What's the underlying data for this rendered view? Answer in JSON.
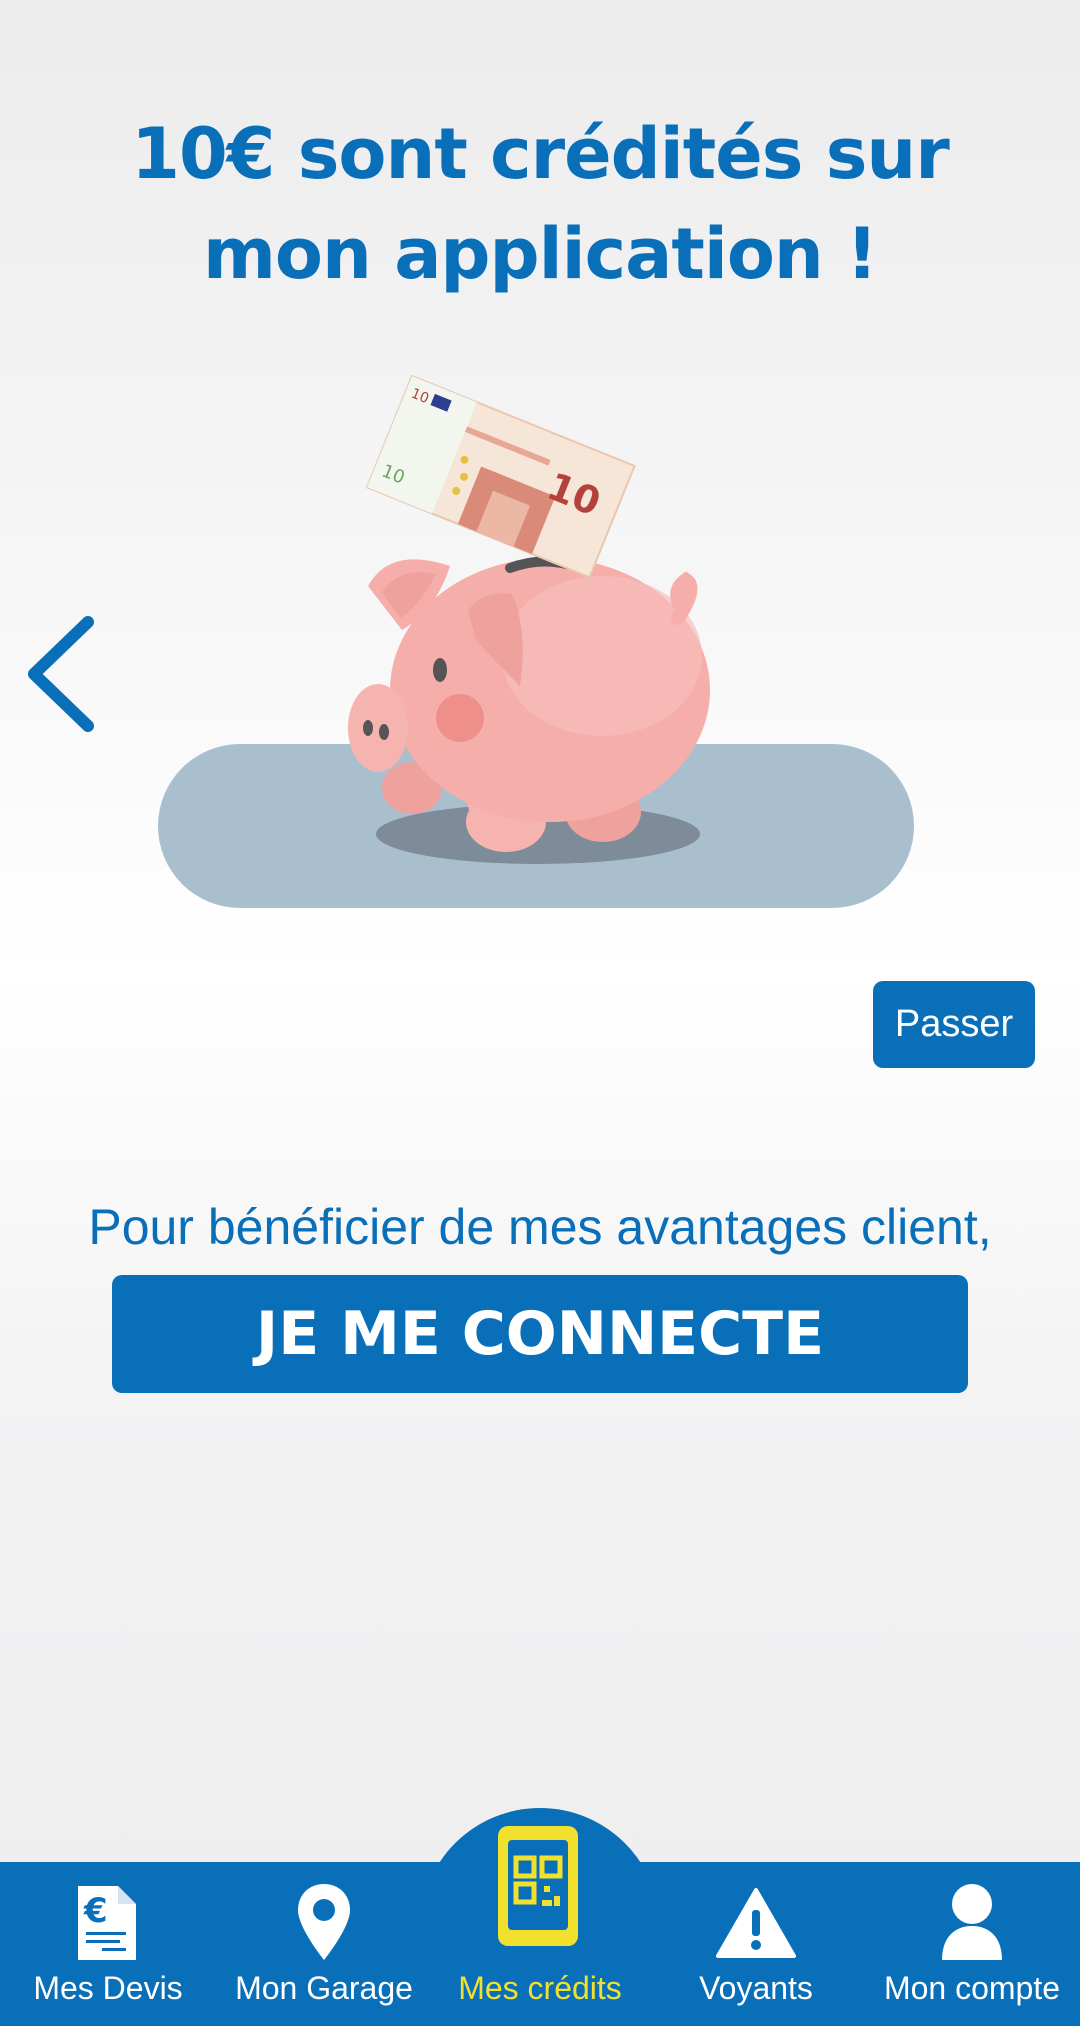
{
  "onboarding": {
    "title": "10€ sont crédités sur mon application !",
    "skip_label": "Passer",
    "benefit_text": "Pour bénéficier de mes avantages client,",
    "connect_label": "JE ME CONNECTE",
    "banknote_value": "10"
  },
  "nav": {
    "items": [
      {
        "label": "Mes Devis",
        "icon": "quote-document-icon"
      },
      {
        "label": "Mon Garage",
        "icon": "location-pin-icon"
      },
      {
        "label": "Mes crédits",
        "icon": "qr-phone-icon",
        "active": true
      },
      {
        "label": "Voyants",
        "icon": "warning-icon"
      },
      {
        "label": "Mon compte",
        "icon": "user-icon"
      }
    ]
  },
  "colors": {
    "primary": "#0a6fb9",
    "active_nav": "#f1e12e",
    "background": "#f3f3f4"
  }
}
